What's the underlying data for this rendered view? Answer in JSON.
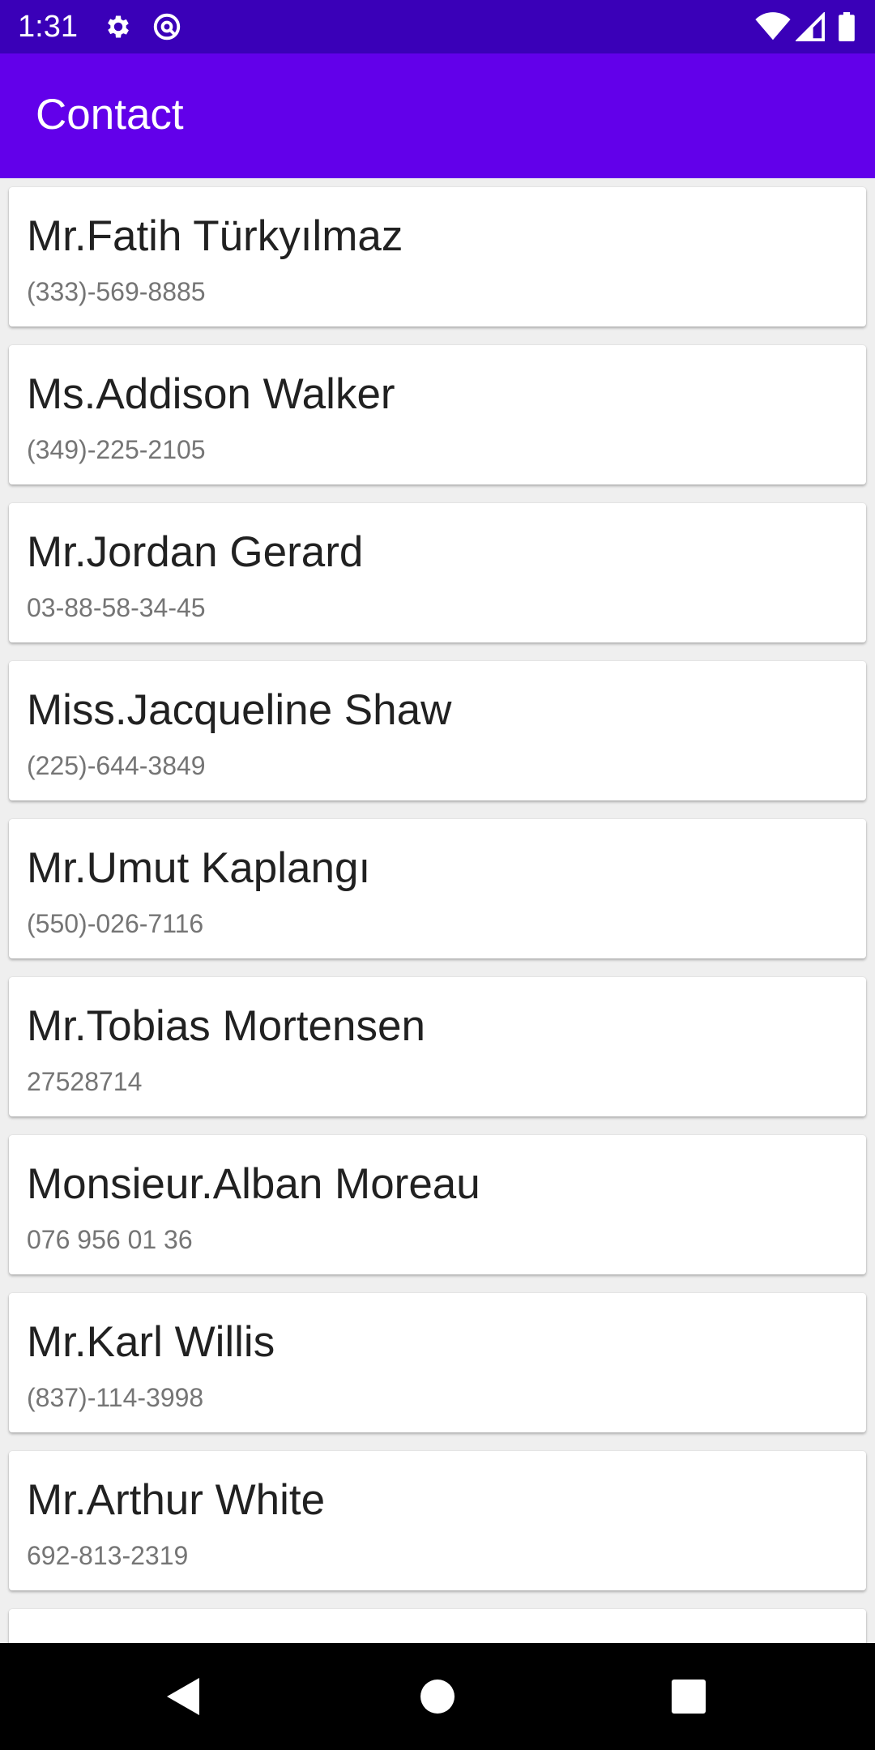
{
  "status_bar": {
    "time": "1:31",
    "icons": [
      "gear-icon",
      "at-sign-icon",
      "wifi-icon",
      "signal-icon",
      "battery-icon"
    ],
    "background": "#3a00b8"
  },
  "app_bar": {
    "title": "Contact",
    "background": "#6200ea"
  },
  "contacts": [
    {
      "name": "Mr.Fatih Türkyılmaz",
      "phone": "(333)-569-8885"
    },
    {
      "name": "Ms.Addison Walker",
      "phone": "(349)-225-2105"
    },
    {
      "name": "Mr.Jordan Gerard",
      "phone": "03-88-58-34-45"
    },
    {
      "name": "Miss.Jacqueline Shaw",
      "phone": "(225)-644-3849"
    },
    {
      "name": "Mr.Umut Kaplangı",
      "phone": "(550)-026-7116"
    },
    {
      "name": "Mr.Tobias Mortensen",
      "phone": "27528714"
    },
    {
      "name": "Monsieur.Alban Moreau",
      "phone": "076 956 01 36"
    },
    {
      "name": "Mr.Karl Willis",
      "phone": "(837)-114-3998"
    },
    {
      "name": "Mr.Arthur White",
      "phone": "692-813-2319"
    },
    {
      "name": "",
      "phone": ""
    }
  ],
  "nav_bar": {
    "buttons": [
      "back-icon",
      "home-icon",
      "recents-icon"
    ]
  }
}
